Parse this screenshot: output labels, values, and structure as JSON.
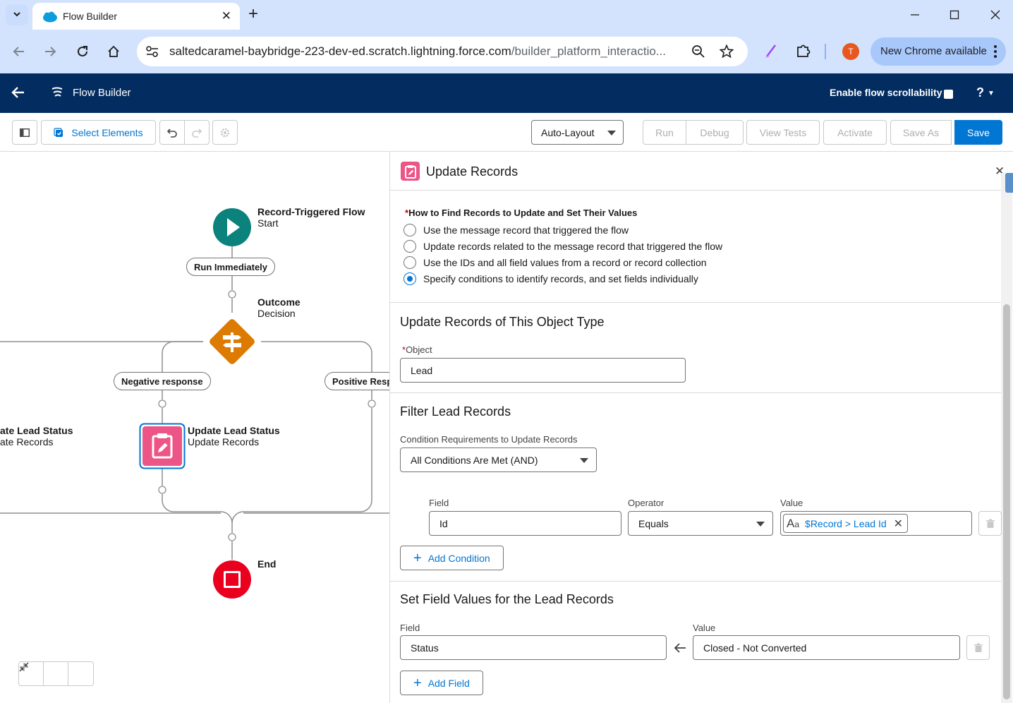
{
  "browser": {
    "tab_title": "Flow Builder",
    "url_host": "saltedcaramel-baybridge-223-dev-ed.scratch.lightning.force.com",
    "url_path": "/builder_platform_interactio...",
    "profile_initial": "T",
    "update_label": "New Chrome available"
  },
  "app": {
    "title": "Flow Builder",
    "scrollability_label": "Enable flow scrollability",
    "help_label": "?"
  },
  "toolbar": {
    "select_elements": "Select Elements",
    "layout_mode": "Auto-Layout",
    "run": "Run",
    "debug": "Debug",
    "view_tests": "View Tests",
    "activate": "Activate",
    "save_as": "Save As",
    "save": "Save"
  },
  "canvas": {
    "start": {
      "title": "Record-Triggered Flow",
      "subtitle": "Start"
    },
    "run_immediately": "Run Immediately",
    "decision": {
      "title": "Outcome",
      "subtitle": "Decision"
    },
    "negative_branch": "Negative response",
    "positive_branch": "Positive Resp",
    "left_node": {
      "title": "ate Lead Status",
      "subtitle": "ate Records"
    },
    "update_node": {
      "title": "Update Lead Status",
      "subtitle": "Update Records"
    },
    "end": {
      "title": "End"
    }
  },
  "panel": {
    "title": "Update Records",
    "how_to_label": "How to Find Records to Update and Set Their Values",
    "options": [
      {
        "label": "Use the message record that triggered the flow",
        "selected": false
      },
      {
        "label": "Update records related to the message record that triggered the flow",
        "selected": false
      },
      {
        "label": "Use the IDs and all field values from a record or record collection",
        "selected": false
      },
      {
        "label": "Specify conditions to identify records, and set fields individually",
        "selected": true
      }
    ],
    "object_section_title": "Update Records of This Object Type",
    "object_label": "Object",
    "object_value": "Lead",
    "filter_section_title": "Filter Lead Records",
    "condition_req_label": "Condition Requirements to Update Records",
    "condition_req_value": "All Conditions Are Met (AND)",
    "condition": {
      "field_label": "Field",
      "field_value": "Id",
      "operator_label": "Operator",
      "operator_value": "Equals",
      "value_label": "Value",
      "value_chip": "$Record > Lead Id"
    },
    "add_condition": "Add Condition",
    "set_section_title": "Set Field Values for the Lead Records",
    "assignment": {
      "field_label": "Field",
      "field_value": "Status",
      "value_label": "Value",
      "value_value": "Closed - Not Converted"
    },
    "add_field": "Add Field"
  },
  "colors": {
    "sf_header": "#032d60",
    "brand_blue": "#0176d3",
    "start_node": "#0b827c",
    "decision_node": "#dd7a01",
    "update_node": "#ec5586",
    "end_node": "#ea001e"
  }
}
